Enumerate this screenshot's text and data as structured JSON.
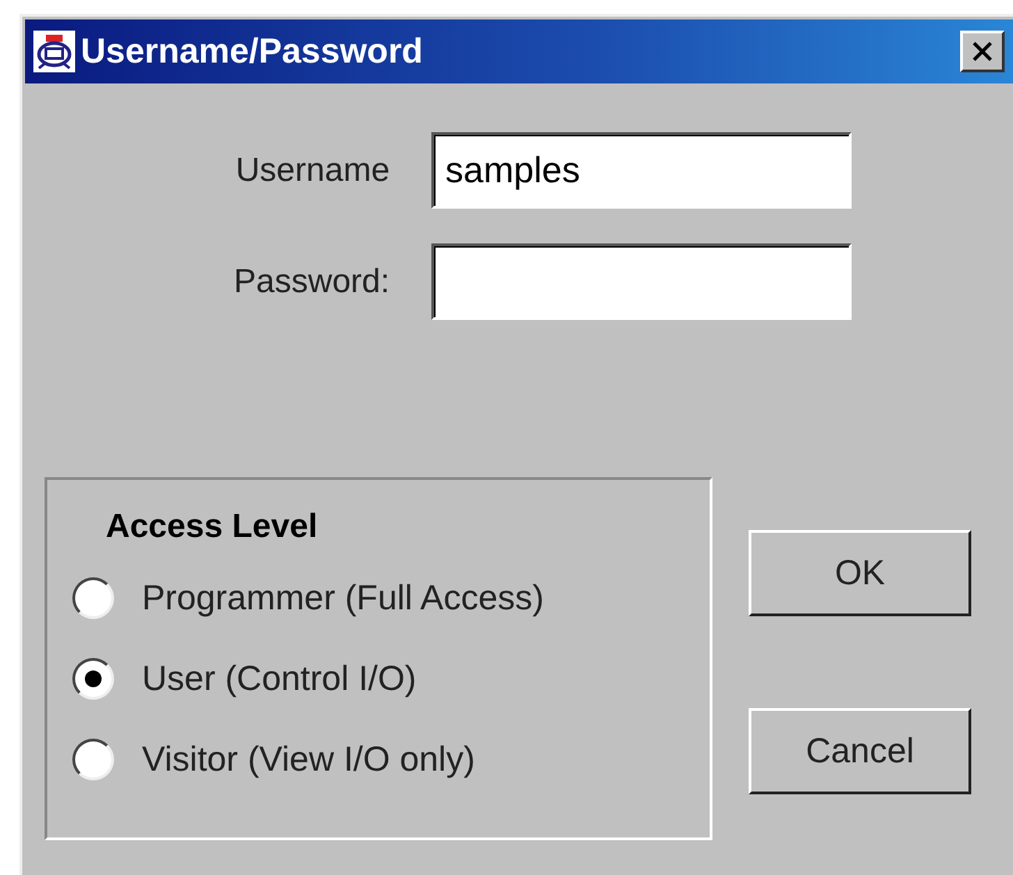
{
  "window": {
    "title": "Username/Password"
  },
  "fields": [
    {
      "label": "Username",
      "value": "samples"
    },
    {
      "label": "Password:"
    }
  ],
  "access_level": {
    "title": "Access Level",
    "options": [
      {
        "label": "Programmer (Full Access)",
        "selected": false
      },
      {
        "label": "User (Control I/O)",
        "selected": true
      },
      {
        "label": "Visitor (View I/O only)",
        "selected": false
      }
    ]
  },
  "buttons": [
    "OK",
    "Cancel"
  ]
}
